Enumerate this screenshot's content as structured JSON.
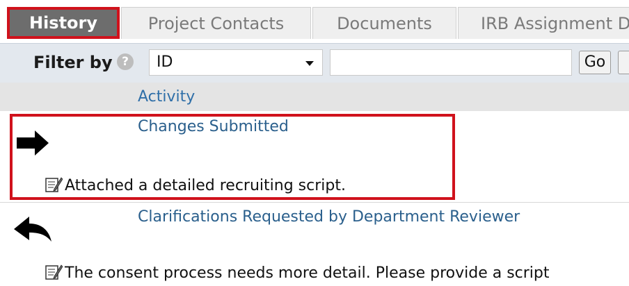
{
  "tabs": [
    {
      "label": "History",
      "active": true
    },
    {
      "label": "Project Contacts"
    },
    {
      "label": "Documents"
    },
    {
      "label": "IRB Assignment D"
    }
  ],
  "filter": {
    "label": "Filter by",
    "help_icon": "?",
    "select_value": "ID",
    "input_value": "",
    "go_label": "Go"
  },
  "table": {
    "column_header": "Activity",
    "entries": [
      {
        "direction_icon": "arrow-right-icon",
        "title": "Changes Submitted",
        "note": "Attached a detailed recruiting script."
      },
      {
        "direction_icon": "arrow-back-icon",
        "title": "Clarifications Requested by Department Reviewer",
        "note": "The consent process needs more detail. Please provide a script"
      }
    ]
  },
  "colors": {
    "highlight": "#d0121c",
    "link": "#2a5f8c",
    "active_tab": "#6d6d6d",
    "filter_bg": "#e3e8ee"
  }
}
